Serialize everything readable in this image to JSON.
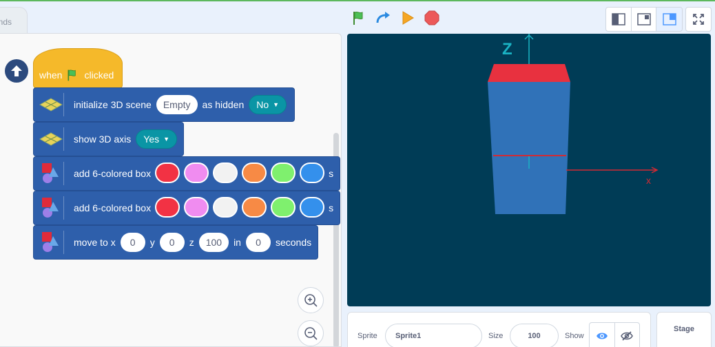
{
  "tabs": {
    "partial_label": "nds"
  },
  "controls": {
    "green_flag": "green-flag-icon",
    "turbo": "turbo-arrow-icon",
    "run": "run-triangle-icon",
    "stop": "stop-sign-icon"
  },
  "layout": {
    "modes": [
      "small-stage",
      "normal-stage",
      "large-stage"
    ],
    "active_mode": "large-stage"
  },
  "script": {
    "hat": {
      "prefix": "when",
      "suffix": "clicked"
    },
    "blocks": [
      {
        "id": "init",
        "label": "initialize 3D scene",
        "value": "Empty",
        "label2": "as hidden",
        "dropdown": "No"
      },
      {
        "id": "axis",
        "label": "show 3D axis",
        "dropdown": "Yes"
      },
      {
        "id": "box1",
        "label": "add 6-colored box",
        "colors": [
          "#f23244",
          "#f08cf0",
          "#f2f2f2",
          "#f78a45",
          "#7ff06e",
          "#3490ec"
        ],
        "trailing": "s"
      },
      {
        "id": "box2",
        "label": "add 6-colored box",
        "colors": [
          "#f23244",
          "#f08cf0",
          "#f2f2f2",
          "#f78a45",
          "#7ff06e",
          "#3490ec"
        ],
        "trailing": "s"
      },
      {
        "id": "move",
        "label_x": "move to x",
        "x": "0",
        "label_y": "y",
        "y": "0",
        "label_z": "z",
        "z": "100",
        "label_in": "in",
        "secs": "0",
        "label_secs": "seconds"
      }
    ]
  },
  "stage": {
    "axis_z": "Z",
    "axis_x": "x",
    "background": "#003c56",
    "box_top_color": "#e8313f",
    "box_side_color": "#3072b8",
    "axis_color": "#d42a33"
  },
  "sprite_info": {
    "sprite_label": "Sprite",
    "sprite_name": "Sprite1",
    "size_label": "Size",
    "size_value": "100",
    "show_label": "Show"
  },
  "stage_tab": {
    "label": "Stage"
  },
  "colors": {
    "hat": "#f5b92a",
    "block": "#2e5fab",
    "dropdown": "#0a95a5",
    "accent": "#4c97ff"
  }
}
